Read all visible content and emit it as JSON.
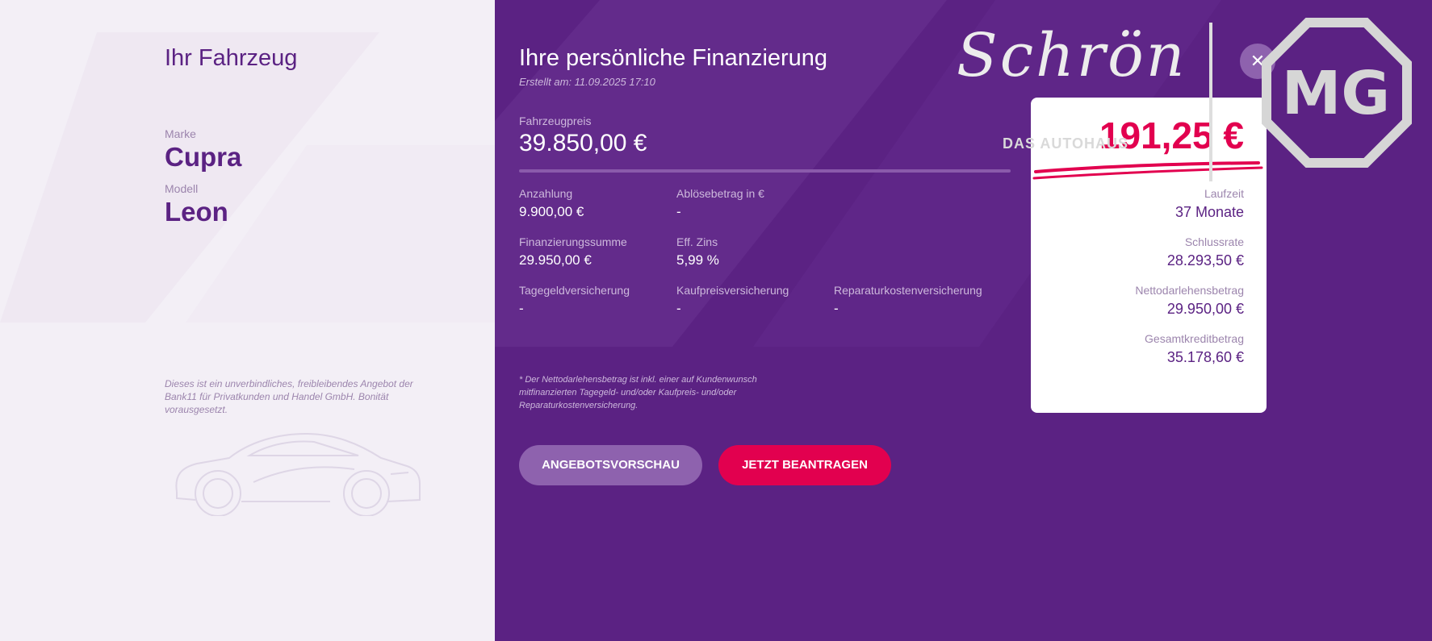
{
  "vehicle": {
    "heading": "Ihr Fahrzeug",
    "brand_label": "Marke",
    "brand_value": "Cupra",
    "model_label": "Modell",
    "model_value": "Leon",
    "disclaimer": "Dieses ist ein unverbindliches, freibleibendes Angebot der Bank11 für Privatkunden und Handel GmbH. Bonität vorausgesetzt."
  },
  "financing": {
    "heading": "Ihre persönliche Finanzierung",
    "created": "Erstellt am: 11.09.2025 17:10",
    "price_label": "Fahrzeugpreis",
    "price_value": "39.850,00 €",
    "fields": [
      {
        "label": "Anzahlung",
        "value": "9.900,00 €"
      },
      {
        "label": "Ablösebetrag in €",
        "value": "-"
      },
      {
        "label": "Finanzierungssumme",
        "value": "29.950,00 €"
      },
      {
        "label": "Eff. Zins",
        "value": "5,99 %"
      },
      {
        "label": "Tagegeldversicherung",
        "value": "-"
      },
      {
        "label": "Kaufpreisversicherung",
        "value": "-"
      },
      {
        "label": "Reparaturkostenversicherung",
        "value": "-"
      }
    ],
    "footnote": "* Der Nettodarlehensbetrag ist inkl. einer auf Kundenwunsch mitfinanzierten Tagegeld- und/oder Kaufpreis- und/oder Reparaturkostenversicherung."
  },
  "buttons": {
    "preview": "ANGEBOTSVORSCHAU",
    "apply": "JETZT BEANTRAGEN"
  },
  "summary": {
    "monthly_rate": "191,25 €",
    "items": [
      {
        "label": "Laufzeit",
        "value": "37 Monate"
      },
      {
        "label": "Schlussrate",
        "value": "28.293,50 €"
      },
      {
        "label": "Nettodarlehensbetrag",
        "value": "29.950,00 €"
      },
      {
        "label": "Gesamtkreditbetrag",
        "value": "35.178,60 €"
      }
    ]
  },
  "close_icon": "close-icon",
  "logo": {
    "script": "Schrön",
    "subtitle": "DAS AUTOHAUS",
    "brand": "MG"
  },
  "colors": {
    "purple": "#5b2283",
    "accent": "#e2004f",
    "light_bg": "#f3eff6"
  }
}
